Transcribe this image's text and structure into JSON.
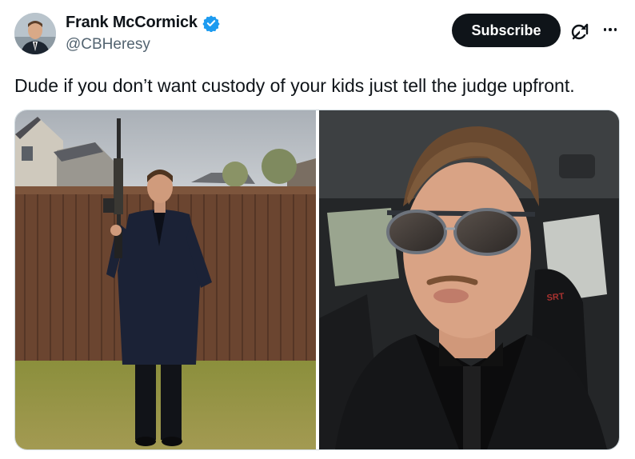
{
  "author": {
    "display_name": "Frank McCormick",
    "handle": "@CBHeresy",
    "verified": true,
    "avatar": "avatar-photo"
  },
  "header": {
    "subscribe_label": "Subscribe",
    "grok_icon": "grok-icon",
    "more_icon": "more-options-icon"
  },
  "tweet": {
    "text": "Dude if you don’t want custody of your kids just tell the judge upfront."
  },
  "media": {
    "images": [
      {
        "name": "photo-man-with-rifle-backyard"
      },
      {
        "name": "photo-man-selfie-in-car-sunglasses"
      }
    ]
  },
  "colors": {
    "text": "#0f1419",
    "secondary_text": "#536471",
    "verified_blue": "#1d9bf0",
    "button_bg": "#0f1419"
  }
}
